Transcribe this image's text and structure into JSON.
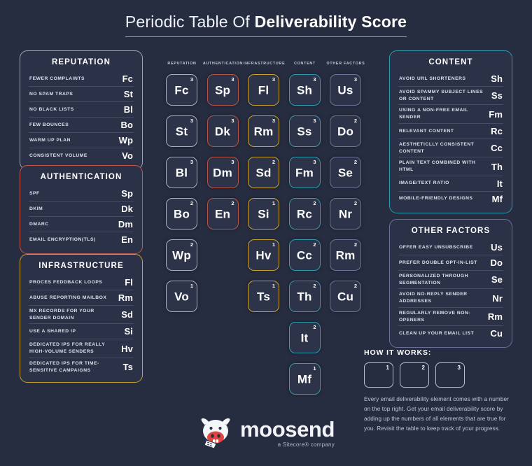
{
  "title": {
    "prefix": "Periodic Table Of ",
    "emphasis": "Deliverability Score"
  },
  "panels": {
    "reputation": {
      "title": "REPUTATION",
      "accent": "#9aa2b8",
      "rows": [
        {
          "label": "FEWER COMPLAINTS",
          "symbol": "Fc"
        },
        {
          "label": "NO SPAM TRAPS",
          "symbol": "St"
        },
        {
          "label": "NO BLACK LISTS",
          "symbol": "Bl"
        },
        {
          "label": "FEW BOUNCES",
          "symbol": "Bo"
        },
        {
          "label": "WARM UP PLAN",
          "symbol": "Wp"
        },
        {
          "label": "CONSISTENT VOLUME",
          "symbol": "Vo"
        }
      ]
    },
    "authentication": {
      "title": "AUTHENTICATION",
      "accent": "#c4564c",
      "rows": [
        {
          "label": "SPF",
          "symbol": "Sp"
        },
        {
          "label": "DKIM",
          "symbol": "Dk"
        },
        {
          "label": "DMARC",
          "symbol": "Dm"
        },
        {
          "label": "EMAIL ENCRYPTION(TLS)",
          "symbol": "En"
        }
      ]
    },
    "infrastructure": {
      "title": "INFRASTRUCTURE",
      "accent": "#c8a02e",
      "rows": [
        {
          "label": "PROCES FEDDBACK LOOPS",
          "symbol": "Fl"
        },
        {
          "label": "ABUSE REPORTING MAILBOX",
          "symbol": "Rm"
        },
        {
          "label": "MX RECORDS FOR YOUR SENDER DOMAIN",
          "symbol": "Sd"
        },
        {
          "label": "USE A SHARED IP",
          "symbol": "Si"
        },
        {
          "label": "DEDICATED IPS FOR REALLY HIGH-VOLUME SENDERS",
          "symbol": "Hv"
        },
        {
          "label": "DEDICATED IPS FOR TIME-SENSITIVE CAMPAIGNS",
          "symbol": "Ts"
        }
      ]
    },
    "content": {
      "title": "CONTENT",
      "accent": "#2e9aad",
      "rows": [
        {
          "label": "AVOID URL SHORTENERS",
          "symbol": "Sh"
        },
        {
          "label": "AVOID SPAMMY SUBJECT LINES OR CONTENT",
          "symbol": "Ss"
        },
        {
          "label": "USING A NON-FREE EMAIL SENDER",
          "symbol": "Fm"
        },
        {
          "label": "RELEVANT CONTENT",
          "symbol": "Rc"
        },
        {
          "label": "AESTHETICLLY CONSISTENT CONTENT",
          "symbol": "Cc"
        },
        {
          "label": "PLAIN TEXT COMBINED WITH HTML",
          "symbol": "Th"
        },
        {
          "label": "IMAGE/TEXT RATIO",
          "symbol": "It"
        },
        {
          "label": "MOBILE-FRIENDLY DESIGNS",
          "symbol": "Mf"
        }
      ]
    },
    "other_factors": {
      "title": "OTHER FACTORS",
      "accent": "#6f6f9b",
      "rows": [
        {
          "label": "OFFER EASY UNSUBSCRIBE",
          "symbol": "Us"
        },
        {
          "label": "PREFER DOUBLE OPT-IN-LIST",
          "symbol": "Do"
        },
        {
          "label": "PERSONALIZED THROUGH SEGMENTATION",
          "symbol": "Se"
        },
        {
          "label": "AVOID NO-REPLY SENDER ADDRESSES",
          "symbol": "Nr"
        },
        {
          "label": "REGULARLY REMOVE NON-OPENERS",
          "symbol": "Rm"
        },
        {
          "label": "CLEAN UP YOUR EMAIL LIST",
          "symbol": "Cu"
        }
      ]
    }
  },
  "periodic_table": {
    "columns": [
      {
        "header": "REPUTATION",
        "key": "rep",
        "accent": "#a8afc3",
        "tiles": [
          {
            "symbol": "Fc",
            "score": "3"
          },
          {
            "symbol": "St",
            "score": "3"
          },
          {
            "symbol": "Bl",
            "score": "3"
          },
          {
            "symbol": "Bo",
            "score": "2"
          },
          {
            "symbol": "Wp",
            "score": "2"
          },
          {
            "symbol": "Vo",
            "score": "1"
          }
        ]
      },
      {
        "header": "AUTHENTICATION",
        "key": "auth",
        "accent": "#b8554b",
        "tiles": [
          {
            "symbol": "Sp",
            "score": "3"
          },
          {
            "symbol": "Dk",
            "score": "3"
          },
          {
            "symbol": "Dm",
            "score": "3"
          },
          {
            "symbol": "En",
            "score": "2"
          }
        ]
      },
      {
        "header": "INFRASTRUCTURE",
        "key": "inf",
        "accent": "#c9a22f",
        "tiles": [
          {
            "symbol": "Fl",
            "score": "3"
          },
          {
            "symbol": "Rm",
            "score": "3"
          },
          {
            "symbol": "Sd",
            "score": "2"
          },
          {
            "symbol": "Si",
            "score": "1"
          },
          {
            "symbol": "Hv",
            "score": "1"
          },
          {
            "symbol": "Ts",
            "score": "1"
          }
        ]
      },
      {
        "header": "CONTENT",
        "key": "con",
        "accent": "#2f9cb0",
        "tiles": [
          {
            "symbol": "Sh",
            "score": "3"
          },
          {
            "symbol": "Ss",
            "score": "3"
          },
          {
            "symbol": "Fm",
            "score": "3"
          },
          {
            "symbol": "Rc",
            "score": "2"
          },
          {
            "symbol": "Cc",
            "score": "2"
          },
          {
            "symbol": "Th",
            "score": "2"
          },
          {
            "symbol": "It",
            "score": "2"
          },
          {
            "symbol": "Mf",
            "score": "1"
          }
        ]
      },
      {
        "header": "OTHER FACTORS",
        "key": "oth",
        "accent": "#72719d",
        "tiles": [
          {
            "symbol": "Us",
            "score": "3"
          },
          {
            "symbol": "Do",
            "score": "2"
          },
          {
            "symbol": "Se",
            "score": "2"
          },
          {
            "symbol": "Nr",
            "score": "2"
          },
          {
            "symbol": "Rm",
            "score": "2"
          },
          {
            "symbol": "Cu",
            "score": "2"
          }
        ]
      }
    ]
  },
  "how_it_works": {
    "title": "HOW IT WORKS:",
    "boxes": [
      "1",
      "2",
      "3"
    ],
    "description": "Every email deliverability element comes with a number on the top right. Get your email deliverability score by adding up the numbers of all elements that are true for you. Revisit the table to keep track of your progress."
  },
  "logo": {
    "name": "moosend",
    "tagline": "a Sitecore® company"
  },
  "theme": {
    "background": "#272d40",
    "panel_fill": "#2b3146",
    "tile_fill": "#2d3348"
  }
}
